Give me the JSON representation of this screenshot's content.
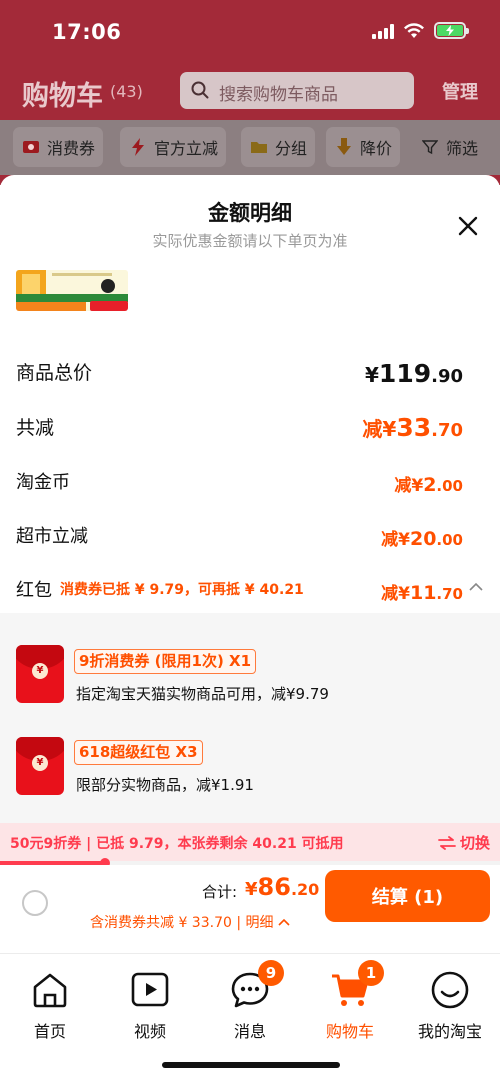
{
  "status_bar": {
    "time": "17:06"
  },
  "header": {
    "title": "购物车",
    "count": "(43)",
    "search_placeholder": "搜索购物车商品",
    "manage": "管理"
  },
  "chips": [
    {
      "label": "消费券",
      "icon": "coupon-icon"
    },
    {
      "label": "官方立减",
      "icon": "lightning-icon"
    },
    {
      "label": "分组",
      "icon": "folder-icon"
    },
    {
      "label": "降价",
      "icon": "price-drop-icon"
    },
    {
      "label": "筛选",
      "icon": "filter-icon"
    }
  ],
  "sheet": {
    "title": "金额明细",
    "subtitle": "实际优惠金额请以下单页为准",
    "rows": [
      {
        "label": "商品总价",
        "prefix": "",
        "currency": "¥",
        "int": "119",
        "dec": ".90"
      },
      {
        "label": "共减",
        "prefix": "减",
        "currency": "¥",
        "int": "33",
        "dec": ".70"
      },
      {
        "label": "淘金币",
        "prefix": "减",
        "currency": "¥",
        "int": "2",
        "dec": ".00"
      },
      {
        "label": "超市立减",
        "prefix": "减",
        "currency": "¥",
        "int": "20",
        "dec": ".00"
      },
      {
        "label": "红包",
        "prefix": "减",
        "currency": "¥",
        "int": "11",
        "dec": ".70"
      }
    ],
    "hongbao_note": "消费券已抵 ¥ 9.79，可再抵 ¥ 40.21",
    "coupons": [
      {
        "tag": "9折消费券 (限用1次) X1",
        "desc": "指定淘宝天猫实物商品可用，减¥9.79"
      },
      {
        "tag": "618超级红包 X3",
        "desc": "限部分实物商品，减¥1.91"
      }
    ],
    "strip": {
      "text_a": "50元9折券",
      "text_b": "已抵 9.79，本张券剩余 40.21 可抵用",
      "switch": "切换"
    }
  },
  "checkout": {
    "total_label": "合计:",
    "currency": "¥",
    "int": "86",
    "dec": ".20",
    "discount_line": "含消费券共减 ¥ 33.70",
    "detail_link": "明细",
    "button": "结算 (1)"
  },
  "tabs": [
    {
      "label": "首页",
      "icon": "home-icon",
      "badge": ""
    },
    {
      "label": "视频",
      "icon": "video-icon",
      "badge": ""
    },
    {
      "label": "消息",
      "icon": "message-icon",
      "badge": "9"
    },
    {
      "label": "购物车",
      "icon": "cart-icon",
      "badge": "1"
    },
    {
      "label": "我的淘宝",
      "icon": "profile-icon",
      "badge": ""
    }
  ],
  "colors": {
    "accent": "#ff5000",
    "header_bg": "#a32a39",
    "strip_bg": "#fde4e6",
    "red_envelope": "#e8111b"
  }
}
